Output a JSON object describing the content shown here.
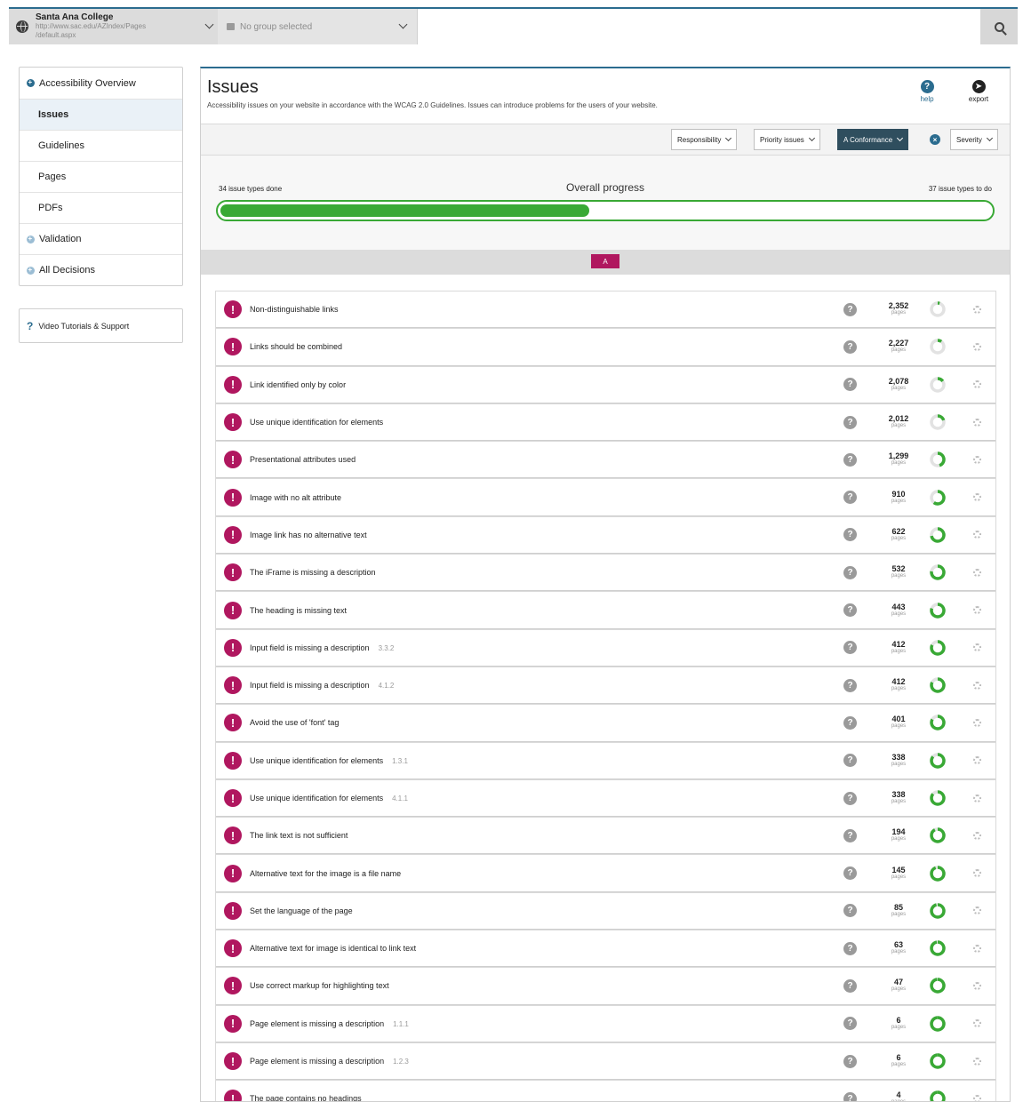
{
  "topbar": {
    "site_name": "Santa Ana College",
    "site_url_line1": "http://www.sac.edu/AZIndex/Pages",
    "site_url_line2": "/default.aspx",
    "group_placeholder": "No group selected"
  },
  "sidebar": {
    "items": [
      {
        "label": "Accessibility Overview"
      },
      {
        "label": "Issues"
      },
      {
        "label": "Guidelines"
      },
      {
        "label": "Pages"
      },
      {
        "label": "PDFs"
      },
      {
        "label": "Validation"
      },
      {
        "label": "All Decisions"
      }
    ],
    "support_label": "Video Tutorials & Support"
  },
  "main": {
    "title": "Issues",
    "description": "Accessibility issues on your website in accordance with the WCAG 2.0 Guidelines. Issues can introduce problems for the users of your website.",
    "help_label": "help",
    "export_label": "export"
  },
  "filters": {
    "responsibility": "Responsibility",
    "priority": "Priority issues",
    "conformance": "A Conformance",
    "severity": "Severity"
  },
  "progress": {
    "title": "Overall progress",
    "done_label": "34 issue types done",
    "todo_label": "37 issue types to do",
    "fraction": 0.479
  },
  "level_badge": "A",
  "pages_unit": "pages",
  "issues": [
    {
      "name": "Non-distinguishable links",
      "ref": "",
      "count": "2,352",
      "done": 0.05
    },
    {
      "name": "Links should be combined",
      "ref": "",
      "count": "2,227",
      "done": 0.1
    },
    {
      "name": "Link identified only by color",
      "ref": "",
      "count": "2,078",
      "done": 0.15
    },
    {
      "name": "Use unique identification for elements",
      "ref": "",
      "count": "2,012",
      "done": 0.2
    },
    {
      "name": "Presentational attributes used",
      "ref": "",
      "count": "1,299",
      "done": 0.45
    },
    {
      "name": "Image with no alt attribute",
      "ref": "",
      "count": "910",
      "done": 0.6
    },
    {
      "name": "Image link has no alternative text",
      "ref": "",
      "count": "622",
      "done": 0.72
    },
    {
      "name": "The iFrame is missing a description",
      "ref": "",
      "count": "532",
      "done": 0.77
    },
    {
      "name": "The heading is missing text",
      "ref": "",
      "count": "443",
      "done": 0.8
    },
    {
      "name": "Input field is missing a description",
      "ref": "3.3.2",
      "count": "412",
      "done": 0.82
    },
    {
      "name": "Input field is missing a description",
      "ref": "4.1.2",
      "count": "412",
      "done": 0.82
    },
    {
      "name": "Avoid the use of 'font' tag",
      "ref": "",
      "count": "401",
      "done": 0.83
    },
    {
      "name": "Use unique identification for elements",
      "ref": "1.3.1",
      "count": "338",
      "done": 0.86
    },
    {
      "name": "Use unique identification for elements",
      "ref": "4.1.1",
      "count": "338",
      "done": 0.86
    },
    {
      "name": "The link text is not sufficient",
      "ref": "",
      "count": "194",
      "done": 0.92
    },
    {
      "name": "Alternative text for the image is a file name",
      "ref": "",
      "count": "145",
      "done": 0.94
    },
    {
      "name": "Set the language of the page",
      "ref": "",
      "count": "85",
      "done": 0.96
    },
    {
      "name": "Alternative text for image is identical to link text",
      "ref": "",
      "count": "63",
      "done": 0.97
    },
    {
      "name": "Use correct markup for highlighting text",
      "ref": "",
      "count": "47",
      "done": 0.98
    },
    {
      "name": "Page element is missing a description",
      "ref": "1.1.1",
      "count": "6",
      "done": 0.99
    },
    {
      "name": "Page element is missing a description",
      "ref": "1.2.3",
      "count": "6",
      "done": 0.99
    },
    {
      "name": "The page contains no headings",
      "ref": "",
      "count": "4",
      "done": 0.99
    }
  ],
  "colors": {
    "accent": "#2b6c8f",
    "issue_badge": "#b0175f",
    "progress_green": "#39a935",
    "ring_track": "#e2e2e2"
  }
}
